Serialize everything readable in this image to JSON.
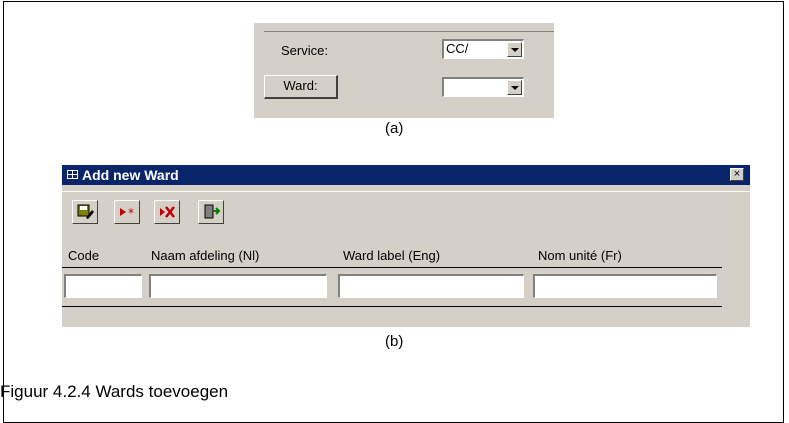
{
  "panel_a": {
    "service_label": "Service:",
    "service_value": "CC/",
    "ward_button": "Ward:",
    "ward_value": "",
    "caption": "(a)"
  },
  "window": {
    "title": "Add new Ward",
    "close_glyph": "×",
    "toolbar": [
      "save-record-icon",
      "new-record-icon",
      "delete-record-icon",
      "close-form-icon"
    ],
    "columns": [
      "Code",
      "Naam afdeling (Nl)",
      "Ward label (Eng)",
      "Nom unité (Fr)"
    ],
    "values": [
      "",
      "",
      "",
      ""
    ],
    "caption": "(b)"
  },
  "figure_caption": "Figuur 4.2.4 Wards toevoegen",
  "colors": {
    "titlebar": "#0a246a",
    "face": "#d4d0c8",
    "icon_red": "#c00000"
  }
}
